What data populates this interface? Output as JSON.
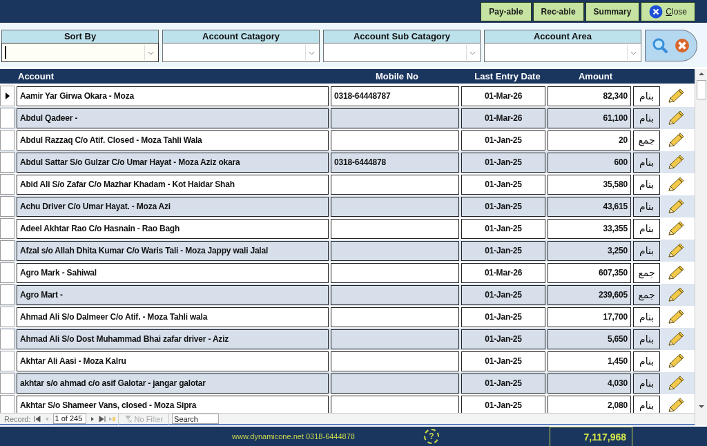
{
  "toolbar": {
    "buttons": [
      {
        "label": "Pay-able",
        "kind": "text"
      },
      {
        "label": "Rec-able",
        "kind": "text"
      },
      {
        "label": "Summary",
        "kind": "text"
      },
      {
        "label": "Close",
        "kind": "close",
        "shortcut_underlined": true
      }
    ]
  },
  "filters": [
    {
      "label": "Sort By",
      "focused": true
    },
    {
      "label": "Account Catagory",
      "focused": false
    },
    {
      "label": "Account Sub Catagory",
      "focused": false
    },
    {
      "label": "Account Area",
      "focused": false
    }
  ],
  "table": {
    "columns": [
      "Account",
      "Mobile No",
      "Last Entry Date",
      "Amount"
    ],
    "rows": [
      {
        "account": "Aamir Yar  Girwa Okara - Moza",
        "mobile": "0318-64448787",
        "date": "01-Mar-26",
        "amount": "82,340",
        "type": "بنام",
        "current": true
      },
      {
        "account": "Abdul Qadeer -",
        "mobile": "",
        "date": "01-Mar-26",
        "amount": "61,100",
        "type": "بنام",
        "current": false
      },
      {
        "account": "Abdul Razzaq C/o Atif. Closed - Moza Tahli Wala",
        "mobile": "",
        "date": "01-Jan-25",
        "amount": "20",
        "type": "جمع",
        "current": false
      },
      {
        "account": "Abdul Sattar S/o Gulzar C/o Umar Hayat - Moza Aziz okara",
        "mobile": "0318-6444878",
        "date": "01-Jan-25",
        "amount": "600",
        "type": "بنام",
        "current": false
      },
      {
        "account": "Abid Ali S/o Zafar C/o Mazhar Khadam - Kot Haidar Shah",
        "mobile": "",
        "date": "01-Jan-25",
        "amount": "35,580",
        "type": "بنام",
        "current": false
      },
      {
        "account": "Achu Driver C/o Umar Hayat. - Moza Azi",
        "mobile": "",
        "date": "01-Jan-25",
        "amount": "43,615",
        "type": "بنام",
        "current": false
      },
      {
        "account": "Adeel Akhtar Rao C/o Hasnain - Rao Bagh",
        "mobile": "",
        "date": "01-Jan-25",
        "amount": "33,355",
        "type": "بنام",
        "current": false
      },
      {
        "account": "Afzal s/o Allah Dhita Kumar C/o Waris Tali - Moza Jappy wali Jalal",
        "mobile": "",
        "date": "01-Jan-25",
        "amount": "3,250",
        "type": "بنام",
        "current": false
      },
      {
        "account": "Agro Mark - Sahiwal",
        "mobile": "",
        "date": "01-Mar-26",
        "amount": "607,350",
        "type": "جمع",
        "current": false
      },
      {
        "account": "Agro Mart -",
        "mobile": "",
        "date": "01-Jan-25",
        "amount": "239,605",
        "type": "جمع",
        "current": false
      },
      {
        "account": "Ahmad Ali S/o Dalmeer C/o Atif. - Moza Tahli wala",
        "mobile": "",
        "date": "01-Jan-25",
        "amount": "17,700",
        "type": "بنام",
        "current": false
      },
      {
        "account": "Ahmad Ali S/o Dost Muhammad Bhai zafar driver - Aziz",
        "mobile": "",
        "date": "01-Jan-25",
        "amount": "5,650",
        "type": "بنام",
        "current": false
      },
      {
        "account": "Akhtar Ali Aasi - Moza Kalru",
        "mobile": "",
        "date": "01-Jan-25",
        "amount": "1,450",
        "type": "بنام",
        "current": false
      },
      {
        "account": "akhtar s/o ahmad c/o asif Galotar - jangar galotar",
        "mobile": "",
        "date": "01-Jan-25",
        "amount": "4,030",
        "type": "بنام",
        "current": false
      },
      {
        "account": "Akhtar S/o Shameer Vans, closed - Moza Sipra",
        "mobile": "",
        "date": "01-Jan-25",
        "amount": "2,080",
        "type": "بنام",
        "current": false
      }
    ]
  },
  "navigation": {
    "label": "Record:",
    "position": "1 of 245",
    "filter": {
      "label": "No Filter",
      "disabled": true
    },
    "search": {
      "placeholder": "Search"
    }
  },
  "footer": {
    "contact": "www.dynamicone.net 0318-6444878",
    "help": "?",
    "total": "7,117,968"
  }
}
